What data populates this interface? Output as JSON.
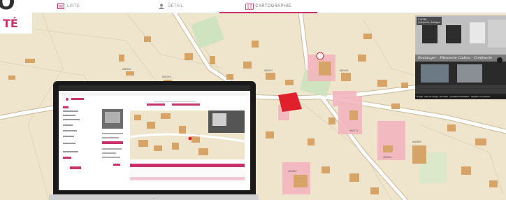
{
  "tabs": [
    {
      "label": "LISTE",
      "icon": "list-icon"
    },
    {
      "label": "DÉTAIL",
      "icon": "user-icon"
    },
    {
      "label": "CARTOGRAPHIE",
      "icon": "map-icon",
      "active": true
    }
  ],
  "brand": {
    "big": "O",
    "small": "TÉ"
  },
  "streetview": {
    "address_line1": "2 D781",
    "address_line2": "Quimperlé, Bretagne",
    "shop_sign": "Boulanger - Pâtisserie Cadiou - Confiserie",
    "footer_left": "Google · Date de l'image : juin 2019",
    "footer_mid": "Conditions d'utilisation",
    "footer_right": "Signaler un problème"
  },
  "colors": {
    "accent": "#c8336b",
    "map_bg": "#f0e6cf",
    "building": "#d9a86b",
    "parcel_highlight": "#f2b3bd",
    "parcel_selected": "#e0202a"
  }
}
